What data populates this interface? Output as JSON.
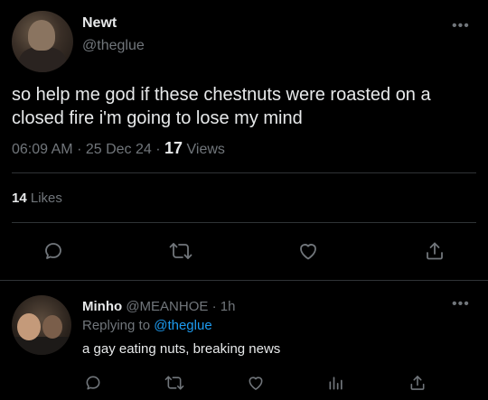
{
  "tweet": {
    "display_name": "Newt",
    "handle": "@theglue",
    "text": "so help me god if these chestnuts were roasted on a closed fire i'm going to lose my mind",
    "time": "06:09 AM",
    "date": "25 Dec 24",
    "views_count": "17",
    "views_label": "Views",
    "likes_count": "14",
    "likes_label": "Likes",
    "more": "•••"
  },
  "reply": {
    "display_name": "Minho",
    "handle": "@MEANHOE",
    "time": "1h",
    "replying_prefix": "Replying to",
    "replying_to": "@theglue",
    "text": "a gay eating nuts, breaking news",
    "more": "•••"
  },
  "colors": {
    "background": "#000000",
    "text": "#e7e9ea",
    "muted": "#71767b",
    "accent": "#1d9bf0",
    "divider": "#2f3336"
  },
  "icons": {
    "actions": [
      "reply-icon",
      "retweet-icon",
      "like-icon",
      "share-icon"
    ],
    "reply_actions": [
      "reply-icon",
      "retweet-icon",
      "like-icon",
      "analytics-icon",
      "share-icon"
    ]
  }
}
